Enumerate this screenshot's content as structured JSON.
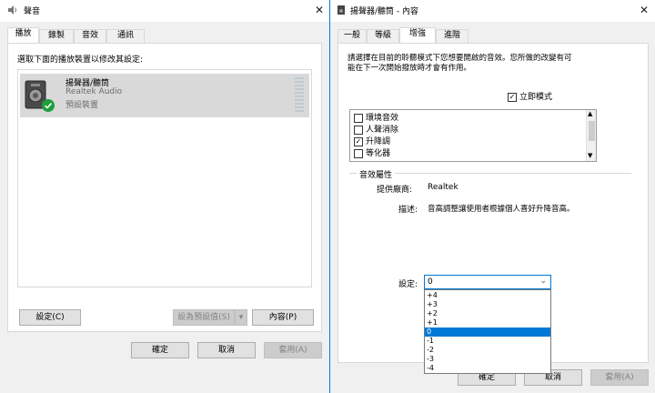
{
  "left_dialog": {
    "title": "聲音",
    "tabs": [
      {
        "label": "播放",
        "active": true
      },
      {
        "label": "錄製",
        "active": false
      },
      {
        "label": "音效",
        "active": false
      },
      {
        "label": "通訊",
        "active": false
      }
    ],
    "instruction": "選取下面的播放裝置以修改其設定:",
    "device": {
      "name": "揚聲器/聽筒",
      "driver": "Realtek Audio",
      "status": "預設裝置"
    },
    "buttons": {
      "configure": "設定(C)",
      "set_default": "設為預設值(S)",
      "properties": "內容(P)",
      "ok": "確定",
      "cancel": "取消",
      "apply": "套用(A)"
    }
  },
  "right_dialog": {
    "title": "揚聲器/聽筒 - 內容",
    "tabs": [
      {
        "label": "一般",
        "active": false
      },
      {
        "label": "等級",
        "active": false
      },
      {
        "label": "增強",
        "active": true
      },
      {
        "label": "進階",
        "active": false
      }
    ],
    "instruction_line1": "請選擇在目前的聆聽模式下您想要開啟的音效。您所做的改變有可",
    "instruction_line2": "能在下一次開始撥放時才會有作用。",
    "immediate_mode": {
      "label": "立即模式",
      "checked": true
    },
    "effects": [
      {
        "label": "環境音效",
        "checked": false
      },
      {
        "label": "人聲消除",
        "checked": false
      },
      {
        "label": "升降調",
        "checked": true
      },
      {
        "label": "等化器",
        "checked": false
      }
    ],
    "properties_group": {
      "legend": "音效屬性",
      "provider_label": "提供廠商:",
      "provider_value": "Realtek",
      "description_label": "描述:",
      "description_value": "音高調整讓使用者根據個人喜好升降音高。",
      "setting_label": "設定:",
      "setting_value": "0",
      "options": [
        "+4",
        "+3",
        "+2",
        "+1",
        "0",
        "-1",
        "-2",
        "-3",
        "-4"
      ],
      "selected_option": "0"
    },
    "buttons": {
      "ok": "確定",
      "cancel": "取消",
      "apply": "套用(A)"
    }
  },
  "colors": {
    "accent": "#0078d7",
    "check_badge": "#1e9e3a",
    "selected_row": "#cde8ff"
  }
}
